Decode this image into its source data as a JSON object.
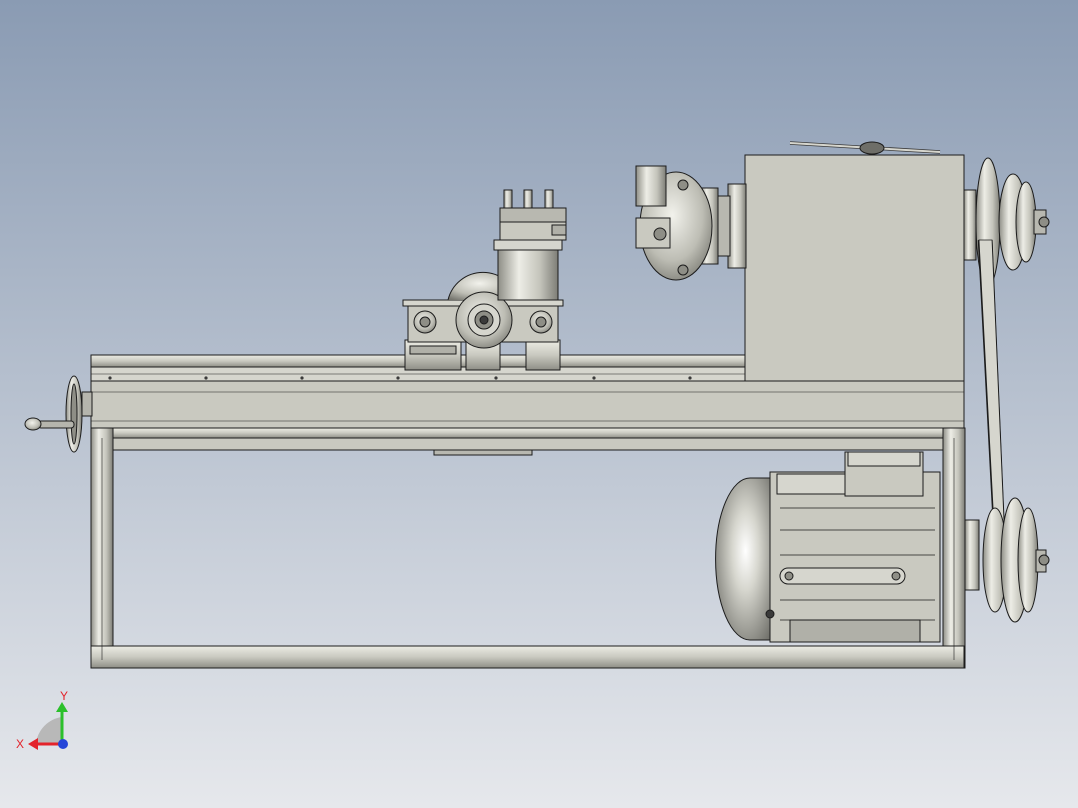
{
  "viewport": {
    "background_top": "#8a9bb3",
    "background_bottom": "#e6e8ec"
  },
  "model": {
    "fill": "#c9c9c0",
    "fill_dark": "#9a9a92",
    "fill_light": "#e4e4dc",
    "edge": "#1c1c1c"
  },
  "triad": {
    "x_label": "X",
    "y_label": "Y",
    "x_color": "#e3232b",
    "y_color": "#2bc02b",
    "z_color": "#2545d8",
    "label_color": "#e3232b"
  }
}
